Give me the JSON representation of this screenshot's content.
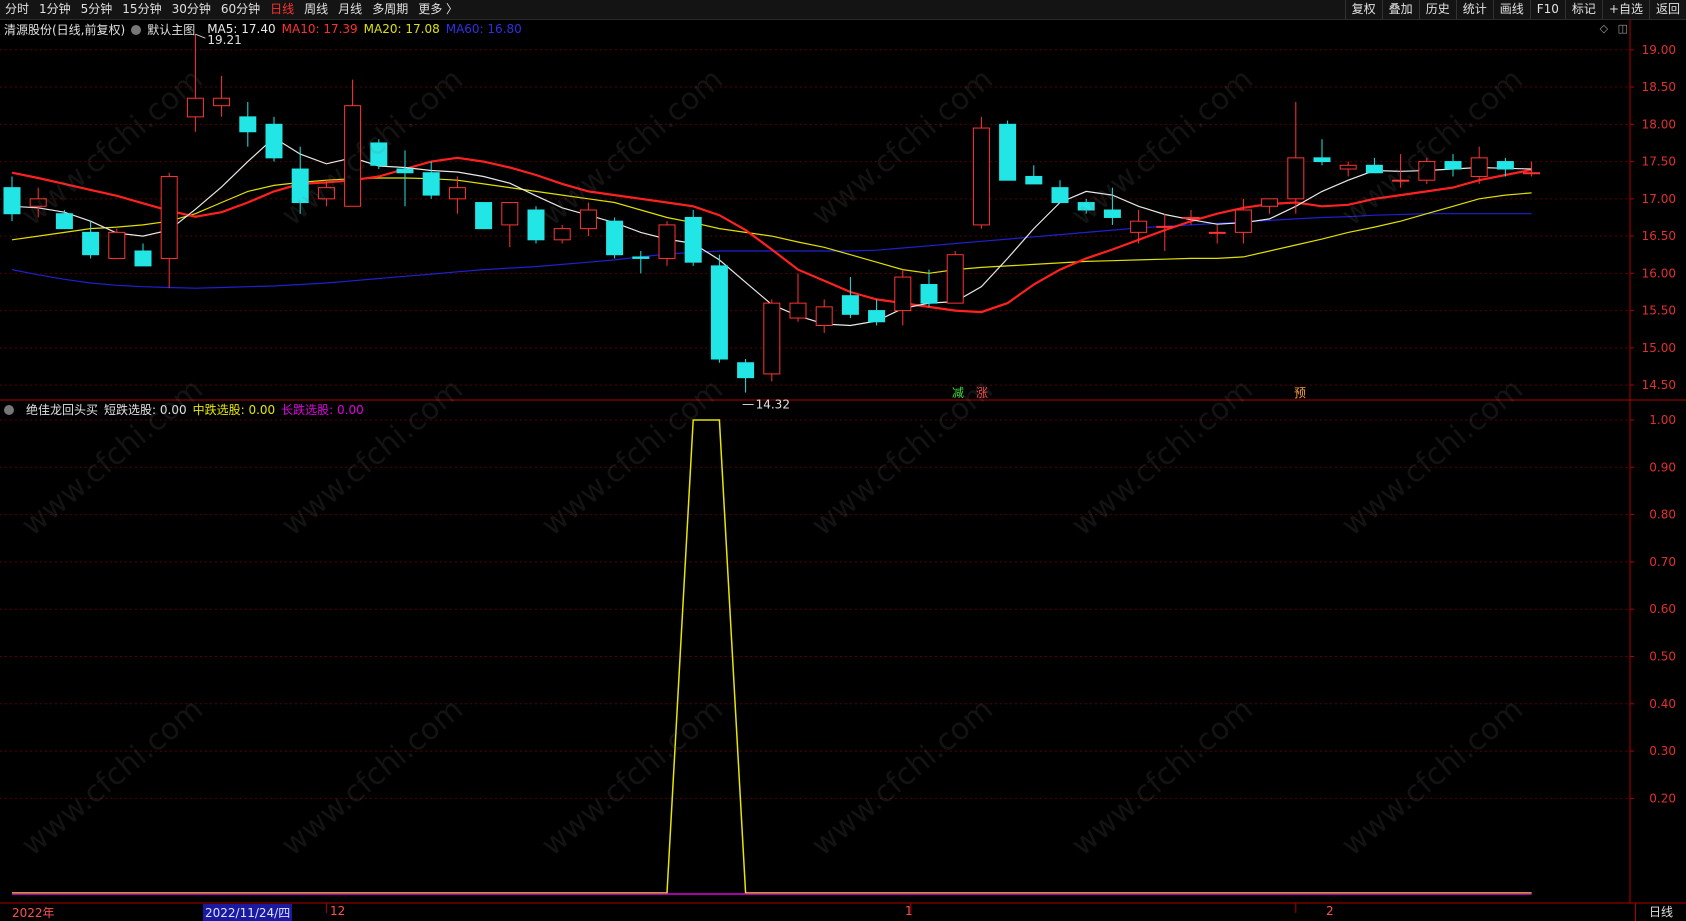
{
  "toolbar": {
    "left": [
      "分时",
      "1分钟",
      "5分钟",
      "15分钟",
      "30分钟",
      "60分钟",
      "日线",
      "周线",
      "月线",
      "多周期",
      "更多 〉"
    ],
    "active": "日线",
    "right": [
      "复权",
      "叠加",
      "历史",
      "统计",
      "画线",
      "F10",
      "标记",
      "+自选",
      "返回"
    ]
  },
  "info_bar": {
    "stock": "清源股份(日线,前复权)",
    "main_chart": "默认主图",
    "ma5": "MA5: 17.40",
    "ma10": "MA10: 17.39",
    "ma20": "MA20: 17.08",
    "ma60": "MA60: 16.80"
  },
  "indicator_bar": {
    "name": "绝佳龙回头买",
    "short": "短跌选股: 0.00",
    "mid": "中跌选股: 0.00",
    "long": "长跌选股: 0.00"
  },
  "annotations": {
    "high": "19.21",
    "low": "14.32",
    "signal1": "减",
    "signal2": "涨",
    "signal3": "预"
  },
  "price_axis": [
    "19.00",
    "18.50",
    "18.00",
    "17.50",
    "17.00",
    "16.50",
    "16.00",
    "15.50",
    "15.00",
    "14.50"
  ],
  "indicator_axis": [
    "1.00",
    "0.90",
    "0.80",
    "0.70",
    "0.60",
    "0.50",
    "0.40",
    "0.30",
    "0.20"
  ],
  "date_axis": {
    "year": "2022年",
    "selected": "2022/11/24/四",
    "m12": "12",
    "m1": "1",
    "m2": "2"
  },
  "period": "日线",
  "watermark": "www.cfchi.com",
  "colors": {
    "up": "#ff3333",
    "down": "#22e5e5",
    "ma5": "#e8e8e8",
    "ma10": "#ff2020",
    "ma20": "#e0e000",
    "ma60": "#2020d0",
    "mid_line": "#e6e600",
    "long_line": "#e000e0"
  },
  "chart_data": [
    {
      "type": "candlestick",
      "title": "清源股份(日线,前复权)",
      "ylim": [
        14.3,
        19.4
      ],
      "candles_ohlc": [
        [
          17.15,
          17.3,
          16.7,
          16.8
        ],
        [
          16.9,
          17.15,
          16.75,
          17.0
        ],
        [
          16.8,
          16.85,
          16.6,
          16.6
        ],
        [
          16.55,
          16.7,
          16.2,
          16.25
        ],
        [
          16.2,
          16.6,
          16.2,
          16.55
        ],
        [
          16.3,
          16.4,
          16.1,
          16.1
        ],
        [
          16.2,
          17.35,
          15.8,
          17.3
        ],
        [
          18.1,
          19.21,
          17.9,
          18.35
        ],
        [
          18.25,
          18.65,
          18.1,
          18.35
        ],
        [
          18.1,
          18.3,
          17.7,
          17.9
        ],
        [
          18.0,
          18.1,
          17.5,
          17.55
        ],
        [
          17.4,
          17.7,
          16.8,
          16.95
        ],
        [
          17.0,
          17.25,
          16.9,
          17.15
        ],
        [
          16.9,
          18.6,
          16.9,
          18.25
        ],
        [
          17.75,
          17.8,
          17.4,
          17.45
        ],
        [
          17.4,
          17.65,
          16.9,
          17.35
        ],
        [
          17.35,
          17.5,
          17.0,
          17.05
        ],
        [
          17.0,
          17.3,
          16.8,
          17.15
        ],
        [
          16.95,
          16.95,
          16.65,
          16.6
        ],
        [
          16.65,
          16.9,
          16.35,
          16.95
        ],
        [
          16.85,
          16.9,
          16.4,
          16.45
        ],
        [
          16.45,
          16.65,
          16.4,
          16.6
        ],
        [
          16.6,
          16.95,
          16.5,
          16.85
        ],
        [
          16.7,
          16.75,
          16.2,
          16.25
        ],
        [
          16.22,
          16.3,
          16.0,
          16.2
        ],
        [
          16.2,
          16.7,
          16.1,
          16.65
        ],
        [
          16.75,
          16.85,
          16.1,
          16.15
        ],
        [
          16.1,
          16.25,
          14.8,
          14.85
        ],
        [
          14.8,
          14.85,
          14.4,
          14.6
        ],
        [
          14.65,
          15.65,
          14.55,
          15.6
        ],
        [
          15.4,
          16.0,
          15.35,
          15.6
        ],
        [
          15.3,
          15.65,
          15.2,
          15.55
        ],
        [
          15.7,
          15.95,
          15.4,
          15.45
        ],
        [
          15.5,
          15.65,
          15.3,
          15.35
        ],
        [
          15.5,
          16.05,
          15.3,
          15.95
        ],
        [
          15.85,
          16.05,
          15.55,
          15.6
        ],
        [
          15.6,
          16.3,
          15.6,
          16.25
        ],
        [
          16.65,
          18.1,
          16.6,
          17.95
        ],
        [
          18.0,
          18.05,
          17.3,
          17.25
        ],
        [
          17.3,
          17.45,
          17.2,
          17.2
        ],
        [
          17.15,
          17.25,
          16.95,
          16.95
        ],
        [
          16.95,
          17.0,
          16.8,
          16.85
        ],
        [
          16.85,
          17.15,
          16.65,
          16.75
        ],
        [
          16.55,
          16.85,
          16.4,
          16.7
        ],
        [
          16.63,
          16.8,
          16.3,
          16.63
        ],
        [
          16.75,
          16.85,
          16.65,
          16.75
        ],
        [
          16.55,
          16.65,
          16.4,
          16.55
        ],
        [
          16.55,
          17.0,
          16.4,
          16.85
        ],
        [
          16.9,
          17.0,
          16.8,
          17.0
        ],
        [
          17.0,
          18.3,
          16.8,
          17.55
        ],
        [
          17.55,
          17.8,
          17.45,
          17.5
        ],
        [
          17.4,
          17.5,
          17.3,
          17.45
        ],
        [
          17.45,
          17.55,
          17.35,
          17.35
        ],
        [
          17.25,
          17.6,
          17.15,
          17.25
        ],
        [
          17.25,
          17.55,
          17.2,
          17.5
        ],
        [
          17.5,
          17.6,
          17.3,
          17.4
        ],
        [
          17.3,
          17.7,
          17.2,
          17.55
        ],
        [
          17.5,
          17.55,
          17.3,
          17.4
        ],
        [
          17.35,
          17.5,
          17.3,
          17.35
        ]
      ],
      "ma5": [
        16.9,
        16.88,
        16.82,
        16.7,
        16.54,
        16.5,
        16.58,
        16.86,
        17.16,
        17.5,
        17.82,
        17.6,
        17.47,
        17.55,
        17.44,
        17.42,
        17.38,
        17.36,
        17.3,
        17.21,
        17.04,
        16.88,
        16.78,
        16.68,
        16.55,
        16.46,
        16.4,
        16.18,
        15.88,
        15.58,
        15.43,
        15.32,
        15.3,
        15.36,
        15.53,
        15.6,
        15.62,
        15.82,
        16.2,
        16.6,
        16.95,
        17.1,
        17.05,
        16.9,
        16.79,
        16.72,
        16.66,
        16.68,
        16.73,
        16.9,
        17.1,
        17.25,
        17.38,
        17.37,
        17.38,
        17.4,
        17.42,
        17.41,
        17.4
      ],
      "ma10": [
        17.35,
        17.28,
        17.2,
        17.12,
        17.04,
        16.94,
        16.84,
        16.76,
        16.82,
        16.95,
        17.1,
        17.2,
        17.22,
        17.25,
        17.3,
        17.4,
        17.5,
        17.55,
        17.5,
        17.42,
        17.32,
        17.2,
        17.1,
        17.05,
        17.0,
        16.95,
        16.9,
        16.78,
        16.58,
        16.32,
        16.05,
        15.9,
        15.75,
        15.65,
        15.6,
        15.55,
        15.5,
        15.48,
        15.6,
        15.85,
        16.05,
        16.2,
        16.32,
        16.45,
        16.58,
        16.7,
        16.8,
        16.88,
        16.93,
        16.95,
        16.9,
        16.92,
        17.0,
        17.05,
        17.1,
        17.15,
        17.25,
        17.32,
        17.39
      ],
      "ma20": [
        16.45,
        16.5,
        16.55,
        16.6,
        16.62,
        16.65,
        16.7,
        16.8,
        16.95,
        17.1,
        17.18,
        17.22,
        17.25,
        17.27,
        17.28,
        17.28,
        17.27,
        17.25,
        17.2,
        17.15,
        17.1,
        17.05,
        17.0,
        16.95,
        16.85,
        16.75,
        16.68,
        16.6,
        16.55,
        16.5,
        16.42,
        16.35,
        16.25,
        16.15,
        16.05,
        16.0,
        16.05,
        16.08,
        16.1,
        16.12,
        16.14,
        16.16,
        16.17,
        16.18,
        16.19,
        16.2,
        16.2,
        16.22,
        16.3,
        16.38,
        16.46,
        16.55,
        16.62,
        16.7,
        16.8,
        16.9,
        17.0,
        17.05,
        17.08
      ],
      "ma60": [
        16.05,
        15.98,
        15.92,
        15.87,
        15.84,
        15.82,
        15.81,
        15.8,
        15.81,
        15.82,
        15.83,
        15.85,
        15.87,
        15.9,
        15.93,
        15.96,
        15.99,
        16.02,
        16.05,
        16.07,
        16.09,
        16.12,
        16.15,
        16.18,
        16.22,
        16.26,
        16.28,
        16.3,
        16.3,
        16.3,
        16.3,
        16.3,
        16.3,
        16.31,
        16.34,
        16.37,
        16.4,
        16.43,
        16.46,
        16.49,
        16.52,
        16.55,
        16.58,
        16.61,
        16.63,
        16.65,
        16.67,
        16.69,
        16.71,
        16.73,
        16.75,
        16.76,
        16.78,
        16.79,
        16.8,
        16.8,
        16.8,
        16.8,
        16.8
      ]
    },
    {
      "type": "line",
      "title": "绝佳龙回头买",
      "ylim": [
        0,
        1.0
      ],
      "series": [
        {
          "name": "短跌选股",
          "values": [
            0
          ]
        },
        {
          "name": "中跌选股",
          "values": [
            0,
            0,
            0,
            0,
            0,
            0,
            0,
            0,
            0,
            0,
            0,
            0,
            0,
            0,
            0,
            0,
            0,
            0,
            0,
            0,
            0,
            0,
            0,
            0,
            0,
            0,
            1,
            1,
            0,
            0,
            0,
            0,
            0,
            0,
            0,
            0,
            0,
            0,
            0,
            0,
            0,
            0,
            0,
            0,
            0,
            0,
            0,
            0,
            0,
            0,
            0,
            0,
            0,
            0,
            0,
            0,
            0,
            0,
            0
          ]
        },
        {
          "name": "长跌选股",
          "values": [
            0
          ]
        }
      ]
    }
  ]
}
